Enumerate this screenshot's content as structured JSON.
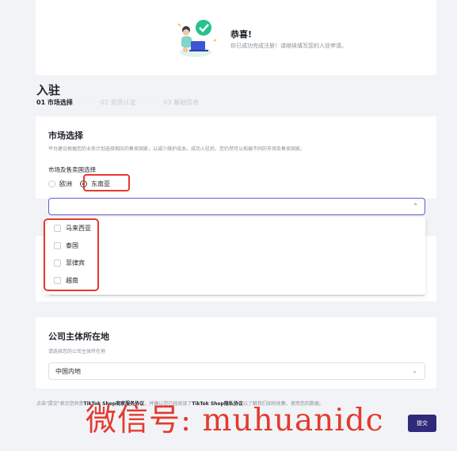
{
  "success": {
    "title": "恭喜!",
    "subtitle": "你已成功完成注册！请继续填写您的入驻申请。"
  },
  "page": {
    "title": "入驻"
  },
  "steps": [
    {
      "label": "01 市场选择",
      "active": true
    },
    {
      "label": "02 资质认证",
      "active": false
    },
    {
      "label": "03 基础信息",
      "active": false
    }
  ],
  "market": {
    "title": "市场选择",
    "description": "平台建议根据您的业务计划选择相应的售卖国家，以减少维护成本。成功入驻后，您仍然可以拓展不同的市场及售卖国家。",
    "region_label": "市场及售卖国选择",
    "regions": [
      {
        "label": "欧洲",
        "selected": false
      },
      {
        "label": "东南亚",
        "selected": true
      }
    ],
    "select_value": "",
    "options": [
      "马来西亚",
      "泰国",
      "菲律宾",
      "越南"
    ]
  },
  "company": {
    "title": "公司主体所在地",
    "description": "请选择您的公司主体所在地",
    "value": "中国内地"
  },
  "footer": {
    "agreement_prefix": "点击\"提交\"表示您同意",
    "agreement_link1": "TikTok Shop商家服务协议",
    "agreement_mid": "，并确认您已经阅读了",
    "agreement_link2": "TikTok Shop隐私协议",
    "agreement_suffix": "以了解我们如何收集、使用您的数据。",
    "submit_label": "提交"
  },
  "watermark": "微信号: muhuanidc",
  "colors": {
    "accent": "#2f2a7a",
    "highlight": "#e6382f",
    "focus_border": "#5a5fc7"
  }
}
